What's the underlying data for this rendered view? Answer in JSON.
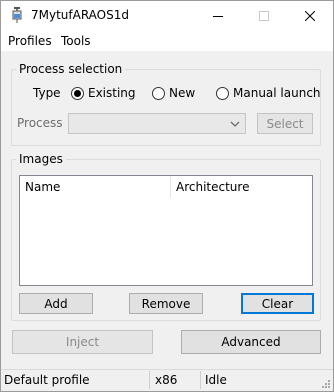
{
  "window": {
    "title": "7MytufARAOS1d"
  },
  "menu": {
    "items": [
      "Profiles",
      "Tools"
    ]
  },
  "process_selection": {
    "group_label": "Process selection",
    "type_label": "Type",
    "options": [
      {
        "label": "Existing",
        "selected": true
      },
      {
        "label": "New",
        "selected": false
      },
      {
        "label": "Manual launch",
        "selected": false
      }
    ],
    "process_label": "Process",
    "process_value": "",
    "select_label": "Select"
  },
  "images": {
    "group_label": "Images",
    "columns": [
      "Name",
      "Architecture"
    ],
    "rows": [],
    "add_label": "Add",
    "remove_label": "Remove",
    "clear_label": "Clear"
  },
  "actions": {
    "inject_label": "Inject",
    "advanced_label": "Advanced"
  },
  "status": {
    "profile": "Default profile",
    "arch": "x86",
    "state": "Idle"
  },
  "colors": {
    "accent": "#0078d7",
    "window_bg": "#f0f0f0"
  }
}
